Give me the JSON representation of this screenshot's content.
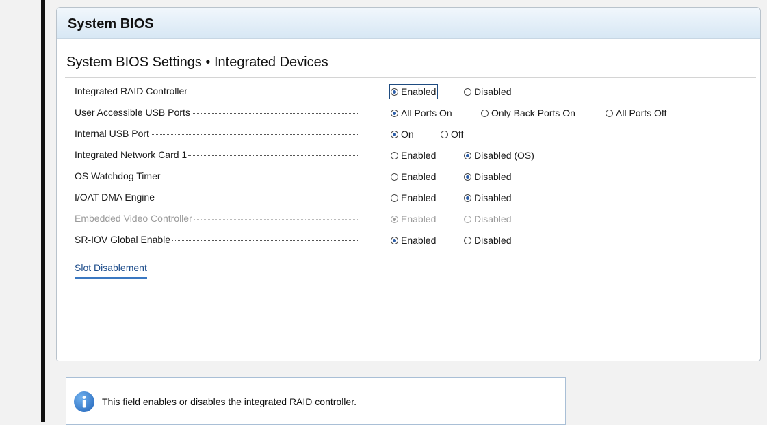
{
  "panel": {
    "title": "System BIOS",
    "section_title": "System BIOS Settings • Integrated Devices"
  },
  "settings": [
    {
      "label": "Integrated RAID Controller",
      "options": [
        "Enabled",
        "Disabled"
      ],
      "selected": 0,
      "focused": 0,
      "disabled": false
    },
    {
      "label": "User Accessible USB Ports",
      "options": [
        "All Ports On",
        "Only Back Ports On",
        "All Ports Off"
      ],
      "selected": 0,
      "disabled": false
    },
    {
      "label": "Internal USB Port",
      "options": [
        "On",
        "Off"
      ],
      "selected": 0,
      "disabled": false
    },
    {
      "label": "Integrated Network Card 1",
      "options": [
        "Enabled",
        "Disabled (OS)"
      ],
      "selected": 1,
      "disabled": false
    },
    {
      "label": "OS Watchdog Timer",
      "options": [
        "Enabled",
        "Disabled"
      ],
      "selected": 1,
      "disabled": false
    },
    {
      "label": "I/OAT DMA Engine",
      "options": [
        "Enabled",
        "Disabled"
      ],
      "selected": 1,
      "disabled": false
    },
    {
      "label": "Embedded Video Controller",
      "options": [
        "Enabled",
        "Disabled"
      ],
      "selected": 0,
      "disabled": true
    },
    {
      "label": "SR-IOV Global Enable",
      "options": [
        "Enabled",
        "Disabled"
      ],
      "selected": 0,
      "disabled": false
    }
  ],
  "links": {
    "slot_disablement": "Slot Disablement"
  },
  "help": {
    "text": "This field enables or disables the integrated RAID controller.",
    "icon": "info-icon"
  },
  "colors": {
    "accent": "#2d5ea8",
    "header_gradient_top": "#f1f7fc",
    "header_gradient_bottom": "#d7e7f4",
    "link": "#1f4e8c"
  }
}
